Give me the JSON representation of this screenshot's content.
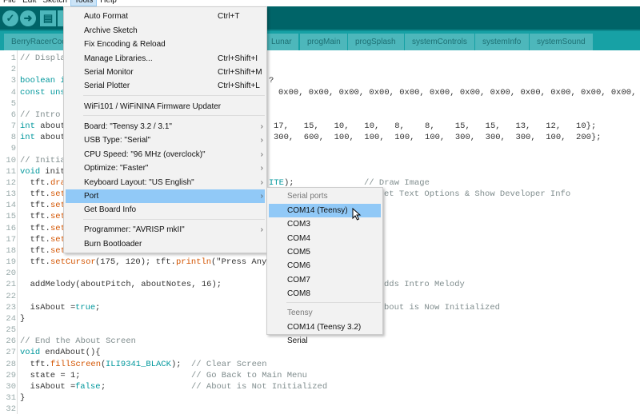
{
  "menubar": [
    "File",
    "Edit",
    "Sketch",
    "Tools",
    "Help"
  ],
  "toolbar": {
    "verify": "✓",
    "upload": "➜",
    "new": "▤"
  },
  "tabs": [
    "BerryRacerCode",
    "Lunar",
    "progMain",
    "progSplash",
    "systemControls",
    "systemInfo",
    "systemSound"
  ],
  "line_numbers": [
    "1",
    "2",
    "3",
    "4",
    "5",
    "6",
    "7",
    "8",
    "9",
    "10",
    "11",
    "12",
    "13",
    "14",
    "15",
    "16",
    "17",
    "18",
    "19",
    "20",
    "21",
    "22",
    "23",
    "24",
    "25",
    "26",
    "27",
    "28",
    "29",
    "30",
    "31",
    "32"
  ],
  "code": {
    "l1": "// Displa",
    "l3a": "boolean i",
    "l3b": "?",
    "l4a": "const uns",
    "l4b": "0x00, 0x00, 0x00, 0x00, 0x00, 0x00, 0x00, 0x00, 0x00, 0x00, 0x00, 0x00,",
    "l6": "// Intro ",
    "l7a": "int",
    "l7b": " about",
    "l7c": "17,   15,   10,   10,   8,    8,    15,   15,   13,   12,   10};",
    "l8a": "int",
    "l8b": " about",
    "l8c": "300,  600,  100,  100,  100,  100,  300,  300,  300,  100,  200};",
    "l10": "// Initia",
    "l11a": "void",
    "l11b": " init",
    "l12a": "  tft.",
    "l12b": "dra",
    "l12c": "ITE",
    "l12c2": ");",
    "l12d": "// Draw Image",
    "l13a": "  tft.",
    "l13b": "set",
    "l13c": "et Text Options & Show Developer Info",
    "set": "set",
    "l19a": "  tft.",
    "l19b": "setCursor",
    "l19c": "(175, 120); tft.",
    "l19d": "println",
    "l19e": "(\"Press Any",
    "l21a": "  addMelody(aboutPitch, aboutNotes, 16);",
    "l21b": "dds Intro Melody",
    "l23a": "  isAbout = ",
    "l23b": "true",
    "l23c": ";",
    "l23d": "bout is Now Initialized",
    "brace_close": "}",
    "l26": "// End the About Screen",
    "l27a": "void",
    "l27b": " endAbout(){",
    "l28a": "  tft.",
    "l28b": "fillScreen",
    "l28c": "(",
    "l28d": "ILI9341_BLACK",
    "l28e": ");  ",
    "l28f": "// Clear Screen",
    "l29a": "  state = 1;                      ",
    "l29b": "// Go Back to Main Menu",
    "l30a": "  isAbout = ",
    "l30b": "false",
    "l30c": ";                ",
    "l30d": "// About is Not Initialized"
  },
  "tools_menu": {
    "items": [
      {
        "label": "Auto Format",
        "shortcut": "Ctrl+T"
      },
      {
        "label": "Archive Sketch"
      },
      {
        "label": "Fix Encoding & Reload"
      },
      {
        "label": "Manage Libraries...",
        "shortcut": "Ctrl+Shift+I"
      },
      {
        "label": "Serial Monitor",
        "shortcut": "Ctrl+Shift+M"
      },
      {
        "label": "Serial Plotter",
        "shortcut": "Ctrl+Shift+L"
      },
      {
        "label": "WiFi101 / WiFiNINA Firmware Updater"
      },
      {
        "label": "Board: \"Teensy 3.2 / 3.1\""
      },
      {
        "label": "USB Type: \"Serial\""
      },
      {
        "label": "CPU Speed: \"96 MHz (overclock)\""
      },
      {
        "label": "Optimize: \"Faster\""
      },
      {
        "label": "Keyboard Layout: \"US English\""
      },
      {
        "label": "Port"
      },
      {
        "label": "Get Board Info"
      },
      {
        "label": "Programmer: \"AVRISP mkII\""
      },
      {
        "label": "Burn Bootloader"
      }
    ],
    "submenu_arrow": "›"
  },
  "port_submenu": {
    "header_serial": "Serial ports",
    "serial_ports": [
      "COM14 (Teensy)",
      "COM3",
      "COM4",
      "COM5",
      "COM6",
      "COM7",
      "COM8"
    ],
    "header_teensy": "Teensy",
    "teensy_ports": [
      "COM14 (Teensy 3.2) Serial"
    ],
    "selected": "COM14 (Teensy)"
  },
  "colors": {
    "toolbar": "#006468",
    "tabbar": "#17a1a5",
    "tab": "#4db7bb",
    "highlight": "#91c9f7",
    "keyword": "#00979c",
    "function": "#d35400"
  }
}
